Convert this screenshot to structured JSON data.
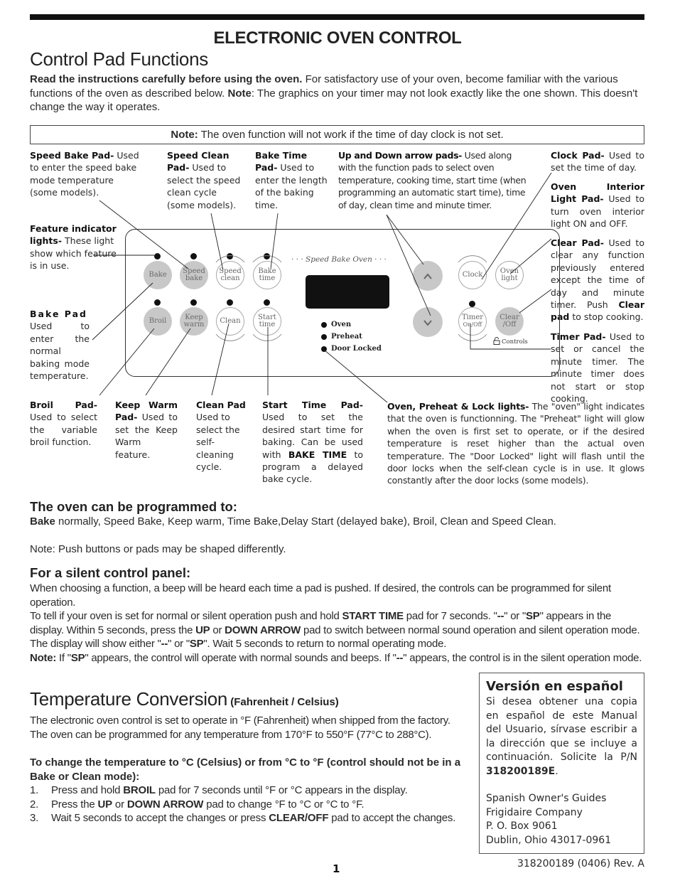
{
  "header": {
    "main_title": "ELECTRONIC OVEN CONTROL",
    "section_title": "Control Pad Functions"
  },
  "intro": {
    "bold_lead": "Read the instructions carefully before using the oven.",
    "text1": " For satisfactory use of your oven, become familiar with the various functions of the oven as described below. ",
    "note_label": "Note",
    "text2": ": The  graphics on your timer may not look exactly like the one shown. This doesn't change the way it operates."
  },
  "note_box": {
    "label": "Note:",
    "text": " The oven function will not work if the time of day clock is not set."
  },
  "callouts": {
    "speed_bake": {
      "title": "Speed Bake Pad-",
      "text": " Used to enter the speed bake mode temperature (some models)."
    },
    "speed_clean": {
      "title": "Speed Clean Pad-",
      "text": " Used to select the speed clean cycle (some models)."
    },
    "bake_time": {
      "title": "Bake Time Pad-",
      "text": " Used to enter the length of the baking time."
    },
    "arrows": {
      "title": "Up and Down arrow pads-",
      "text": " Used along with the function pads to select oven temperature, cooking time, start time (when programming an automatic start time), time of day, clean time and minute timer."
    },
    "clock": {
      "title": "Clock Pad-",
      "text": " Used to set the time of day."
    },
    "oven_light": {
      "title": "Oven Interior Light Pad-",
      "text": " Used to turn oven interior light ON and OFF."
    },
    "clear": {
      "title": "Clear Pad-",
      "text1": " Used to clear any function previously entered except the time of day and minute timer. Push ",
      "bold": "Clear pad",
      "text2": " to stop cooking."
    },
    "timer": {
      "title": "Timer Pad-",
      "text": " Used to set or cancel the minute timer. The minute timer does not start or stop cooking."
    },
    "feature_lights": {
      "title": "Feature indicator lights-",
      "text": " These light show which feature is in use."
    },
    "bake": {
      "title": "Bake Pad",
      "text": "Used to enter the normal baking mode temperature."
    },
    "broil": {
      "title": "Broil Pad-",
      "text": "Used to select the variable broil function."
    },
    "keep_warm": {
      "title": "Keep Warm Pad-",
      "text": " Used to set the Keep Warm feature."
    },
    "clean": {
      "title": "Clean Pad",
      "text": "Used to select the self-cleaning cycle."
    },
    "start_time": {
      "title": "Start Time Pad-",
      "text1": " Used to set the desired start time for baking. Can be used with ",
      "bold": "BAKE TIME",
      "text2": " to program a delayed bake cycle."
    },
    "lights": {
      "title": "Oven, Preheat & Lock lights-",
      "text": " The \"oven\" light indicates that the oven is functionning. The \"Preheat\" light will glow when the oven is first set to operate, or if the desired temperature is reset higher than the actual oven temperature. The \"Door Locked\" light will flash until the door locks when the self-clean cycle is in use. It glows constantly after the door locks (some models)."
    }
  },
  "panel": {
    "brand_label": "· · ·  Speed Bake Oven  · · ·",
    "pads": {
      "bake": "Bake",
      "speed_bake": [
        "Speed",
        "bake"
      ],
      "speed_clean": [
        "Speed",
        "clean"
      ],
      "bake_time": [
        "Bake",
        "time"
      ],
      "broil": "Broil",
      "keep_warm": [
        "Keep",
        "warm"
      ],
      "clean": "Clean",
      "start_time": [
        "Start",
        "time"
      ],
      "up": "^",
      "down": "v",
      "clock": "Clock",
      "oven_light": [
        "Oven",
        "light"
      ],
      "timer": [
        "Timer",
        "On/Off"
      ],
      "clear_off": [
        "Clear",
        "/Off"
      ]
    },
    "indicators": [
      "Oven",
      "Preheat",
      "Door Locked"
    ],
    "controls_label": "Controls"
  },
  "programmed": {
    "heading": "The oven can be programmed to:",
    "bold": "Bake",
    "text": " normally, Speed Bake, Keep warm, Time Bake,Delay Start (delayed bake), Broil, Clean and Speed Clean.",
    "note": "Note: Push buttons or pads may be shaped differently."
  },
  "silent": {
    "heading": "For a silent control panel:",
    "p1": "When choosing a function, a beep will be heard each time a pad is pushed.  If desired, the controls can be programmed for silent operation.",
    "p2_a": "To tell if your oven is set for normal or silent operation push and hold ",
    "p2_b": "START TIME",
    "p2_c": " pad for 7 seconds. \"",
    "p2_d": "--",
    "p2_e": "\" or \"",
    "p2_f": "SP",
    "p2_g": "\" appears in the display. Within 5 seconds, press the ",
    "p2_h": "UP",
    "p2_i": " or ",
    "p2_j": "DOWN ARROW",
    "p2_k": " pad to switch between normal sound operation and silent operation mode. The display will show either \"",
    "p2_l": "--",
    "p2_m": "\" or \"",
    "p2_n": "SP",
    "p2_o": "\". Wait 5 seconds to return to normal operating mode.",
    "p3_a": "Note:",
    "p3_b": " If \"",
    "p3_c": "SP",
    "p3_d": "\" appears, the control will operate with normal sounds and beeps. If \"",
    "p3_e": "--",
    "p3_f": "\" appears, the control is in the silent operation mode."
  },
  "temperature": {
    "heading": "Temperature Conversion",
    "subheading": " (Fahrenheit / Celsius)",
    "p1": "The electronic oven control is set to operate in °F (Fahrenheit) when shipped from the factory. The oven can be programmed for any temperature from 170°F to 550°F (77°C to 288°C).",
    "change_heading": "To change the temperature to °C (Celsius) or from °C to °F (control should not be in a Bake or Clean mode):",
    "steps": [
      {
        "n": "1.",
        "a": "Press and hold ",
        "b": "BROIL",
        "c": " pad for 7 seconds until °F or °C appears in the display."
      },
      {
        "n": "2.",
        "a": "Press the ",
        "b": "UP",
        "c": " or ",
        "d": "DOWN ARROW",
        "e": " pad to change °F to °C or °C to °F."
      },
      {
        "n": "3.",
        "a": "Wait 5 seconds to accept the changes or press ",
        "b": "CLEAR/OFF",
        "c": " pad to accept the changes."
      }
    ]
  },
  "spanish": {
    "heading": "Versión en español",
    "text": "Si desea obtener una copia en español de este Manual del Usuario, sírvase escribir a la dirección que se incluye a continuación. Solicite la P/N ",
    "part_number": "318200189E",
    "period": ".",
    "address": [
      "Spanish Owner's Guides",
      "Frigidaire Company",
      "P. O. Box 9061",
      "Dublin, Ohio 43017-0961"
    ]
  },
  "footer": {
    "page_number": "1",
    "doc_code": "318200189 (0406) Rev. A"
  }
}
